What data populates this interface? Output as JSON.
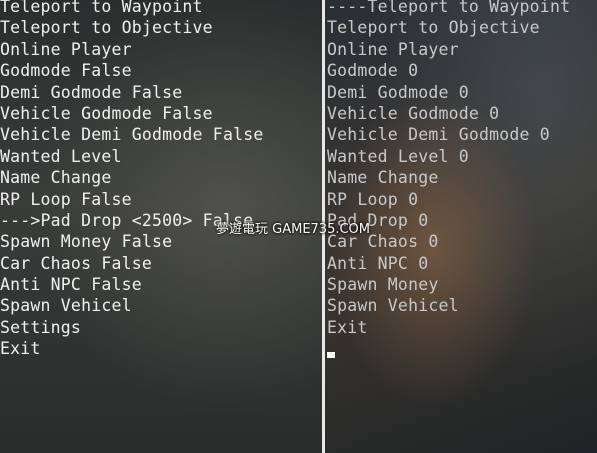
{
  "left_menu": {
    "items": [
      "Teleport to Waypoint",
      "Teleport to Objective",
      "Online Player",
      "Godmode False",
      "Demi Godmode False",
      "Vehicle Godmode False",
      "Vehicle Demi Godmode False",
      "Wanted Level",
      "Name Change",
      "RP Loop False",
      "--->Pad Drop <2500> False",
      "Spawn Money False",
      "Car Chaos False",
      "Anti NPC False",
      "Spawn Vehicel",
      "Settings",
      "Exit"
    ],
    "selected_index": 10
  },
  "right_menu": {
    "items": [
      "----Teleport to Waypoint",
      "Teleport to Objective",
      "Online Player",
      "Godmode 0",
      "Demi Godmode 0",
      "Vehicle Godmode 0",
      "Vehicle Demi Godmode 0",
      "Wanted Level 0",
      "Name Change",
      "RP Loop 0",
      "Pad Drop 0",
      "Car Chaos 0",
      "Anti NPC 0",
      "Spawn Money",
      "Spawn Vehicel",
      "Exit"
    ],
    "selected_index": 0
  },
  "watermark": "夢遊電玩 GAME735.COM",
  "colors": {
    "left_text": "#f0f0f0",
    "right_text": "#c9c9c9",
    "divider": "#e8e8e8"
  }
}
